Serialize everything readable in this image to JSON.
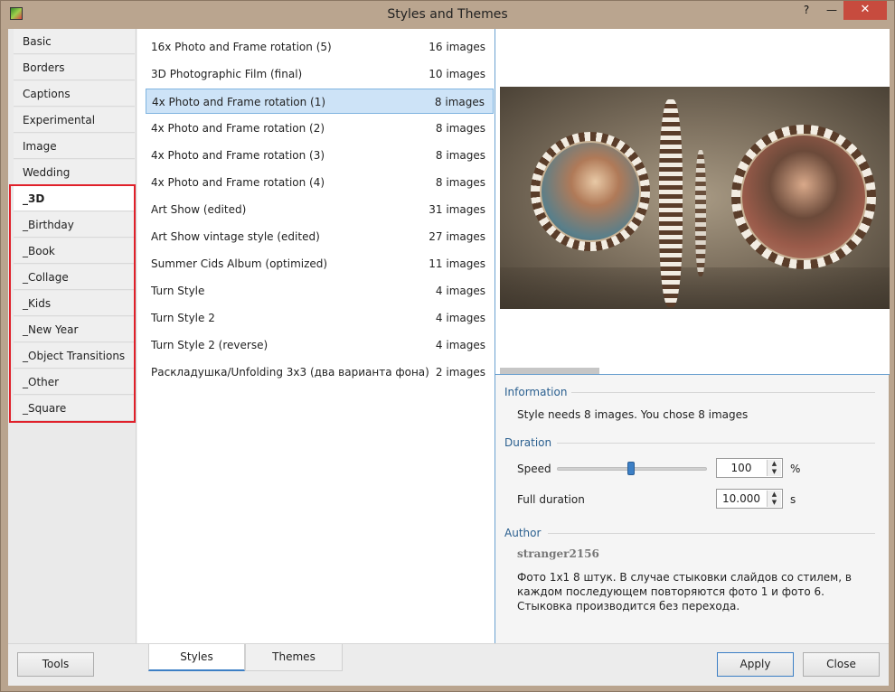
{
  "window": {
    "title": "Styles and Themes",
    "help_glyph": "?",
    "minimize_glyph": "—",
    "close_glyph": "✕"
  },
  "categories": [
    {
      "label": "Basic",
      "selected": false
    },
    {
      "label": "Borders",
      "selected": false
    },
    {
      "label": "Captions",
      "selected": false
    },
    {
      "label": "Experimental",
      "selected": false
    },
    {
      "label": "Image",
      "selected": false
    },
    {
      "label": "Wedding",
      "selected": false
    },
    {
      "label": "_3D",
      "selected": true
    },
    {
      "label": "_Birthday",
      "selected": false
    },
    {
      "label": "_Book",
      "selected": false
    },
    {
      "label": "_Collage",
      "selected": false
    },
    {
      "label": "_Kids",
      "selected": false
    },
    {
      "label": "_New Year",
      "selected": false
    },
    {
      "label": "_Object Transitions",
      "selected": false
    },
    {
      "label": "_Other",
      "selected": false
    },
    {
      "label": "_Square",
      "selected": false
    }
  ],
  "styles": [
    {
      "name": "16x Photo and Frame rotation (5)",
      "count": "16 images",
      "selected": false
    },
    {
      "name": "3D Photographic Film (final)",
      "count": "10 images",
      "selected": false
    },
    {
      "name": "4x Photo and Frame rotation (1)",
      "count": "8 images",
      "selected": true
    },
    {
      "name": "4x Photo and Frame rotation (2)",
      "count": "8 images",
      "selected": false
    },
    {
      "name": "4x Photo and Frame rotation (3)",
      "count": "8 images",
      "selected": false
    },
    {
      "name": "4x Photo and Frame rotation (4)",
      "count": "8 images",
      "selected": false
    },
    {
      "name": "Art Show (edited)",
      "count": "31 images",
      "selected": false
    },
    {
      "name": "Art Show vintage style (edited)",
      "count": "27 images",
      "selected": false
    },
    {
      "name": "Summer Cids Album (optimized)",
      "count": "11 images",
      "selected": false
    },
    {
      "name": "Turn Style",
      "count": "4 images",
      "selected": false
    },
    {
      "name": "Turn Style 2",
      "count": "4 images",
      "selected": false
    },
    {
      "name": "Turn Style 2 (reverse)",
      "count": "4 images",
      "selected": false
    },
    {
      "name": "Раскладушка/Unfolding 3x3 (два варианта фона)",
      "count": "2 images",
      "selected": false
    }
  ],
  "information": {
    "heading": "Information",
    "text": "Style needs 8 images. You chose 8 images"
  },
  "duration": {
    "heading": "Duration",
    "speed_label": "Speed",
    "speed_value": "100",
    "speed_unit": "%",
    "full_label": "Full duration",
    "full_value": "10.000",
    "full_unit": "s",
    "slider_level": 0.5,
    "up_glyph": "▲",
    "down_glyph": "▼"
  },
  "author": {
    "heading": "Author",
    "name": "stranger2156",
    "description": "Фото 1x1 8 штук. В случае стыковки слайдов со стилем, в каждом последующем повторяются фото 1 и фото 6. Стыковка производится без перехода."
  },
  "bottom": {
    "tools_label": "Tools",
    "tab_styles": "Styles",
    "tab_themes": "Themes",
    "apply_label": "Apply",
    "close_label": "Close"
  },
  "colors": {
    "highlight_border": "#e0202a",
    "selection": "#cde3f7",
    "accent": "#3c7fc5",
    "titlebar_close": "#c74b3e"
  }
}
